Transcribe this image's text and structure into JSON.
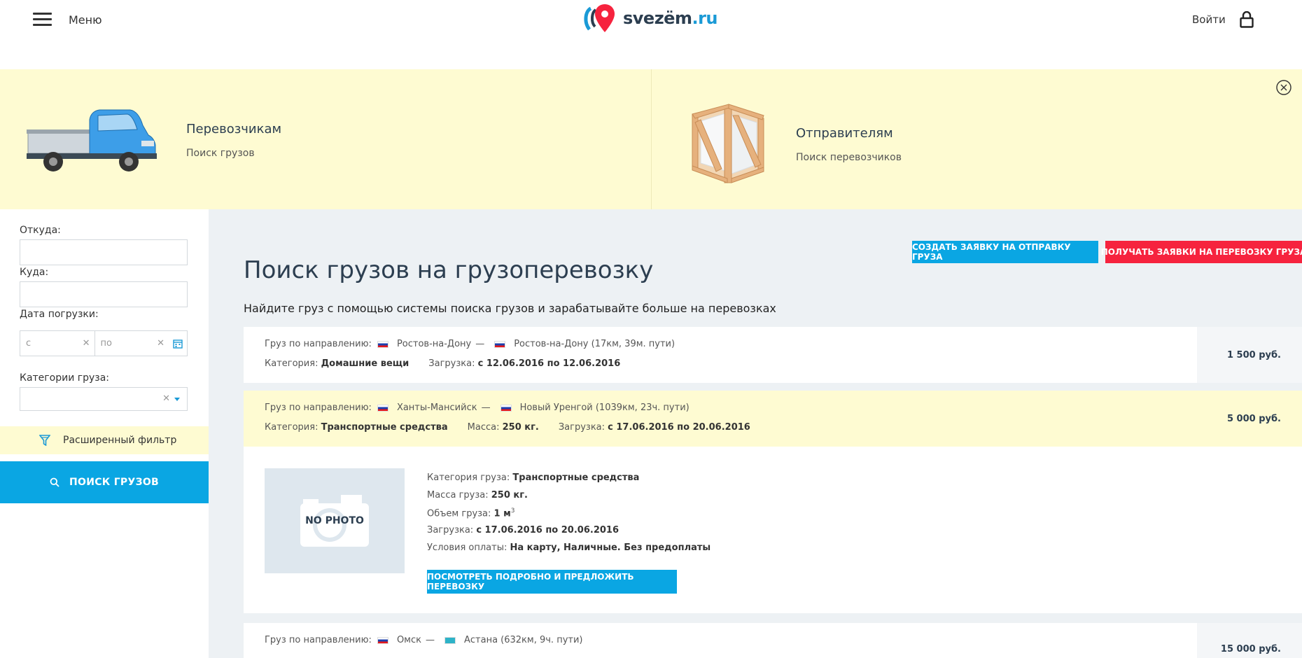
{
  "header": {
    "menu_label": "Меню",
    "logo_name": "svezëm",
    "logo_tld": ".ru",
    "login_label": "Войти"
  },
  "banner": {
    "carriers_title": "Перевозчикам",
    "carriers_sub": "Поиск грузов",
    "senders_title": "Отправителям",
    "senders_sub": "Поиск перевозчиков"
  },
  "filters": {
    "from_label": "Откуда:",
    "to_label": "Куда:",
    "date_label": "Дата погрузки:",
    "date_from_placeholder": "с",
    "date_to_placeholder": "по",
    "category_label": "Категории груза:",
    "extended_filter": "Расширенный фильтр",
    "search_button": "ПОИСК ГРУЗОВ"
  },
  "actions": {
    "create_request": "СОЗДАТЬ ЗАЯВКУ НА ОТПРАВКУ ГРУЗА",
    "receive_requests": "ПОЛУЧАТЬ ЗАЯВКИ НА ПЕРЕВОЗКУ ГРУЗА"
  },
  "page": {
    "title": "Поиск грузов на грузоперевозку",
    "description": "Найдите груз с помощью системы поиска грузов и зарабатывайте больше на перевозках"
  },
  "labels": {
    "direction": "Груз по направлению:",
    "category": "Категория:",
    "mass": "Масса:",
    "loading": "Загрузка:",
    "dash": "—"
  },
  "cargos": [
    {
      "from": "Ростов-на-Дону",
      "to": "Ростов-на-Дону",
      "distance": "(17км, 39м. пути)",
      "category": "Домашние вещи",
      "loading": "с 12.06.2016 по 12.06.2016",
      "price": "1 500 руб."
    },
    {
      "from": "Ханты-Мансийск",
      "to": "Новый Уренгой",
      "distance": "(1039км, 23ч. пути)",
      "category": "Транспортные средства",
      "mass": "250 кг.",
      "loading": "с 17.06.2016 по 20.06.2016",
      "price": "5 000 руб."
    },
    {
      "from": "Омск",
      "to": "Астана",
      "distance": "(632км, 9ч. пути)",
      "price": "15 000 руб."
    }
  ],
  "detail": {
    "no_photo": "NO PHOTO",
    "category_label": "Категория груза:",
    "category_value": "Транспортные средства",
    "mass_label": "Масса груза:",
    "mass_value": "250 кг.",
    "volume_label": "Объем груза:",
    "volume_value": "1 м",
    "volume_sup": "3",
    "loading_label": "Загрузка:",
    "loading_value": "с 17.06.2016 по 20.06.2016",
    "payment_label": "Условия оплаты:",
    "payment_value": "На карту, Наличные. Без предоплаты",
    "button": "ПОСМОТРЕТЬ ПОДРОБНО И ПРЕДЛОЖИТЬ ПЕРЕВОЗКУ"
  },
  "colors": {
    "accent": "#0aa6e3",
    "danger": "#f6233e",
    "banner_bg": "#fefbd2",
    "main_bg": "#edf1f4"
  },
  "icons": [
    "hamburger-icon",
    "logo-icon",
    "lock-icon",
    "close-icon",
    "calendar-icon",
    "funnel-icon",
    "search-icon",
    "camera-icon"
  ]
}
